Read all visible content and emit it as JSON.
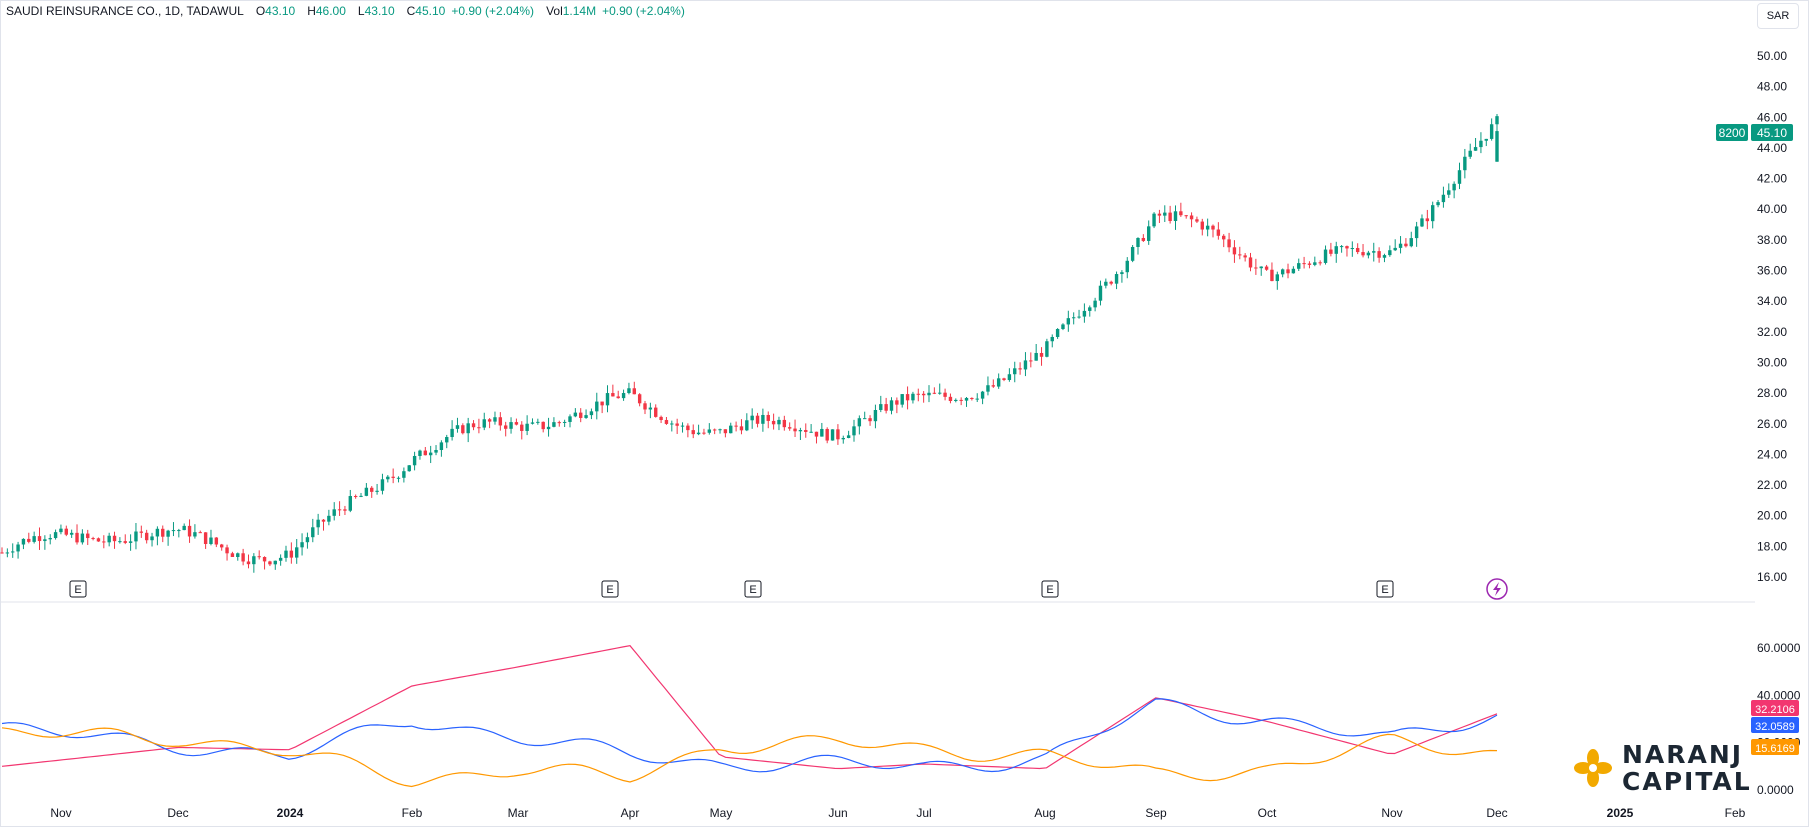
{
  "header": {
    "symbol": "SAUDI REINSURANCE CO., 1D, TADAWUL",
    "o_label": "O",
    "o_value": "43.10",
    "h_label": "H",
    "h_value": "46.00",
    "l_label": "L",
    "l_value": "43.10",
    "c_label": "C",
    "c_value": "45.10",
    "change": "+0.90 (+2.04%)",
    "vol_label": "Vol",
    "vol_value": "1.14M",
    "vol_change": "+0.90 (+2.04%)"
  },
  "currency": "SAR",
  "price_axis": {
    "ticks": [
      "16.00",
      "18.00",
      "20.00",
      "22.00",
      "24.00",
      "26.00",
      "28.00",
      "30.00",
      "32.00",
      "34.00",
      "36.00",
      "38.00",
      "40.00",
      "42.00",
      "44.00",
      "46.00",
      "48.00",
      "50.00"
    ],
    "last_ticker": "8200",
    "last_price": "45.10"
  },
  "indicator_axis": {
    "ticks": [
      "0.0000",
      "20.0000",
      "40.0000",
      "60.0000"
    ],
    "labels": [
      {
        "text": "32.2106",
        "color": "#f23670"
      },
      {
        "text": "32.0589",
        "color": "#2962ff"
      },
      {
        "text": "15.6169",
        "color": "#ff9800"
      }
    ]
  },
  "time_axis": {
    "labels": [
      "Nov",
      "Dec",
      "2024",
      "Feb",
      "Mar",
      "Apr",
      "May",
      "Jun",
      "Jul",
      "Aug",
      "Sep",
      "Oct",
      "Nov",
      "Dec",
      "2025",
      "Feb"
    ],
    "bold": [
      "2024",
      "2025"
    ]
  },
  "earnings_markers": [
    "E",
    "E",
    "E",
    "E",
    "E"
  ],
  "colors": {
    "up": "#089981",
    "down": "#f23645",
    "adx": "#f23670",
    "plus_di": "#2962ff",
    "minus_di": "#ff9800",
    "grid": "#e0e3eb"
  },
  "logo": {
    "line1": "NARANJ",
    "line2": "CAPITAL"
  },
  "chart_data": [
    {
      "type": "candlestick",
      "title": "SAUDI REINSURANCE CO., 1D, TADAWUL",
      "ylim": [
        15,
        51
      ],
      "x": [
        "Nov",
        "Dec",
        "2024",
        "Feb",
        "Mar",
        "Apr",
        "May",
        "Jun",
        "Jul",
        "Aug",
        "Sep",
        "Oct",
        "Nov",
        "Dec"
      ],
      "series": [
        {
          "name": "Close (approx. month-start)",
          "values": [
            17.6,
            18.5,
            18.2,
            23.6,
            25.6,
            28.2,
            25.8,
            25.0,
            27.4,
            31.0,
            39.2,
            35.8,
            38.2,
            45.1
          ]
        }
      ],
      "last": {
        "open": 43.1,
        "high": 46.0,
        "low": 43.1,
        "close": 45.1
      }
    },
    {
      "type": "line",
      "ylim": [
        0,
        70
      ],
      "x": [
        "Nov",
        "Dec",
        "2024",
        "Feb",
        "Mar",
        "Apr",
        "May",
        "Jun",
        "Jul",
        "Aug",
        "Sep",
        "Oct",
        "Nov",
        "Dec"
      ],
      "series": [
        {
          "values": [
            10.0,
            18.0,
            17.0,
            44.0,
            52.0,
            61.0,
            14.0,
            9.0,
            11.0,
            9.0,
            39.0,
            29.0,
            15.0,
            32.2106
          ]
        },
        {
          "values": [
            26.0,
            19.0,
            14.0,
            30.0,
            22.0,
            15.0,
            11.0,
            11.0,
            10.0,
            13.0,
            36.0,
            30.0,
            21.0,
            32.0589
          ]
        },
        {
          "values": [
            24.0,
            22.0,
            16.0,
            4.0,
            9.0,
            5.0,
            19.0,
            20.0,
            17.0,
            15.0,
            6.0,
            9.0,
            20.0,
            15.6169
          ]
        }
      ]
    }
  ]
}
